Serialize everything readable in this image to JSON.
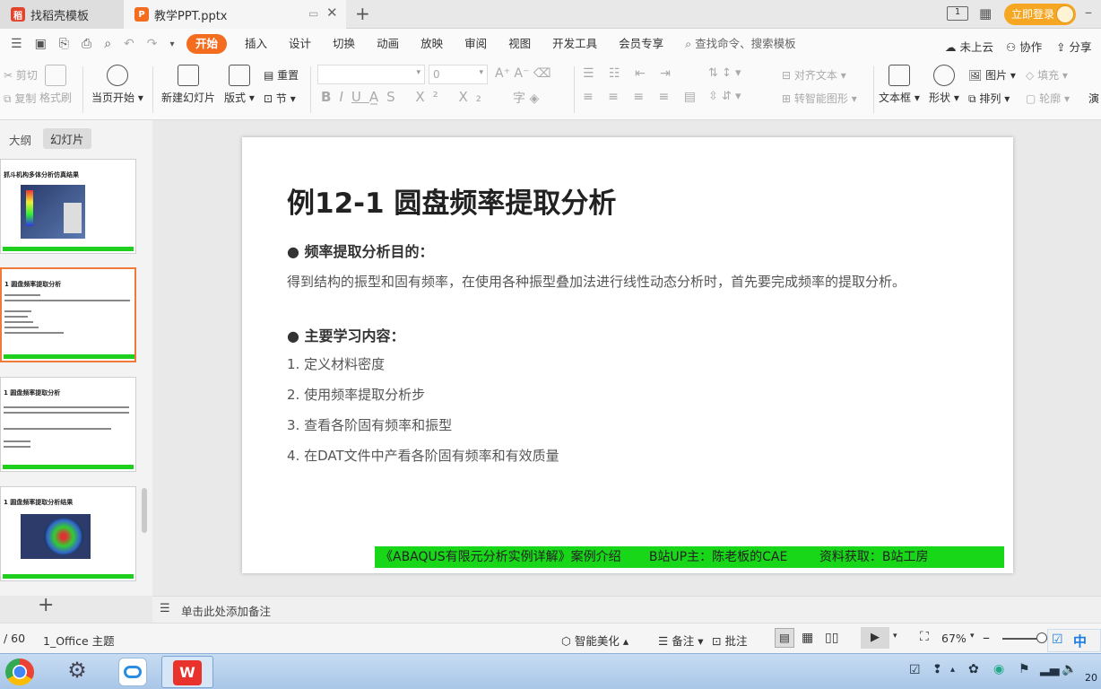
{
  "tabs": [
    {
      "label": "找稻壳模板",
      "icon": "daoke-icon"
    },
    {
      "label": "教学PPT.pptx",
      "icon": "presentation-file-icon"
    }
  ],
  "titlebar": {
    "login_label": "立即登录"
  },
  "menu": {
    "items": [
      "开始",
      "插入",
      "设计",
      "切换",
      "动画",
      "放映",
      "审阅",
      "视图",
      "开发工具",
      "会员专享"
    ],
    "search": "查找命令、搜索模板",
    "right": [
      "未上云",
      "协作",
      "分享"
    ]
  },
  "ribbon": {
    "cut": "剪切",
    "copy": "复制",
    "format_painter": "格式刷",
    "play_current": "当页开始",
    "new_slide": "新建幻灯片",
    "layout": "版式",
    "reset": "重置",
    "section": "节",
    "font_size": "0",
    "align_text": "对齐文本",
    "smartart": "转智能图形",
    "textbox": "文本框",
    "shapes": "形状",
    "picture": "图片",
    "arrange": "排列",
    "fill": "填充",
    "outline": "轮廓",
    "extra": "演"
  },
  "panel": {
    "tab_outline": "大纲",
    "tab_slides": "幻灯片",
    "thumbs": [
      "抓斗机构多体分析仿真结果",
      "1 圆盘频率提取分析",
      "1 圆盘频率提取分析",
      "1 圆盘频率提取分析结果"
    ]
  },
  "slide": {
    "title": "例12-1 圆盘频率提取分析",
    "purpose_heading": "● 频率提取分析目的：",
    "purpose_text": "得到结构的振型和固有频率，在使用各种振型叠加法进行线性动态分析时，首先要完成频率的提取分析。",
    "content_heading": "● 主要学习内容：",
    "items": [
      "1. 定义材料密度",
      "2. 使用频率提取分析步",
      "3. 查看各阶固有频率和振型",
      "4. 在DAT文件中产看各阶固有频率和有效质量"
    ],
    "footer": "《ABAQUS有限元分析实例详解》案例介绍       B站UP主：陈老板的CAE        资料获取：B站工房",
    "footer_color": "#18d618"
  },
  "notes": {
    "placeholder": "单击此处添加备注"
  },
  "status": {
    "page": "/ 60",
    "theme": "1_Office 主题",
    "beautify": "智能美化",
    "notes": "备注",
    "comments": "批注",
    "zoom": "67%"
  },
  "taskbar": {
    "ime": "中",
    "clock": "20"
  },
  "colors": {
    "accent": "#f46d1f",
    "login": "#f5a623"
  }
}
